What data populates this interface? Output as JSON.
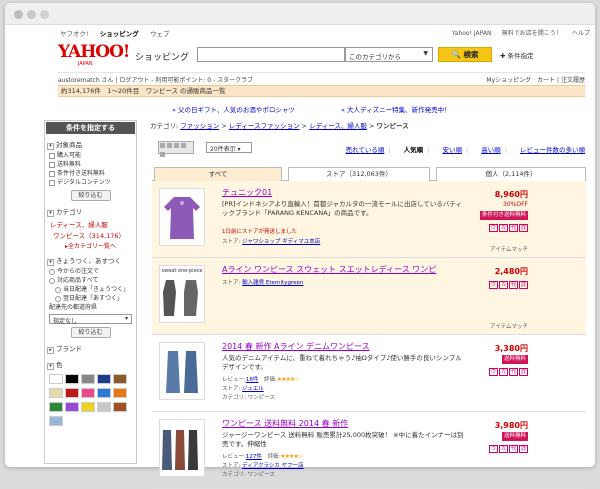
{
  "topnav": {
    "left": [
      "ヤフオク!",
      "ショッピング",
      "ウェブ"
    ],
    "right": [
      "Yahoo! JAPAN",
      "無料でお店を開こう！",
      "ヘルプ"
    ]
  },
  "logo": {
    "text": "YAHOO!",
    "sub": "JAPAN",
    "service": "ショッピング"
  },
  "search": {
    "placeholder": "",
    "category": "このカテゴリから",
    "button": "検索",
    "condition": "条件指定"
  },
  "userbar": {
    "left": "austorematch さん | ログアウト - 利用可能ポイント: 0 - スタークラブ",
    "right": "Myショッピング　カート | 注文履歴"
  },
  "result_bar": "約314,176件　1〜20件目　ワンピース の通販商品一覧",
  "promos": [
    "父の日ギフト、人気のお酒やポロシャツ",
    "大人ディズニー特集、新作発売中！"
  ],
  "sidebar": {
    "title": "条件を指定する",
    "target": {
      "head": "対象商品",
      "options": [
        "購入可能",
        "送料無料",
        "条件付き送料無料",
        "デジタルコンテンツ"
      ],
      "button": "絞り込む"
    },
    "category": {
      "head": "カテゴリ",
      "path": "レディース、婦人服",
      "current": "ワンピース（314,176）",
      "link": "▸全カテゴリー覧へ"
    },
    "delivery": {
      "head": "きょうつく、あすつく",
      "options": [
        "今からの注文で",
        "対応商品すべて",
        "当日配達「きょうつく」",
        "翌日配達「あすつく」"
      ],
      "pref_label": "配達先の都道府県",
      "pref_value": "指定なし",
      "button": "絞り込む"
    },
    "brand": {
      "head": "ブランド"
    },
    "color": {
      "head": "色",
      "swatches": [
        "#ffffff",
        "#000000",
        "#888888",
        "#1a3c8a",
        "#8b5a2b",
        "#e8d8b0",
        "#c01818",
        "#e84a8a",
        "#2a7ad8",
        "#e87818",
        "#2a8a3a",
        "#9a4ad8",
        "#f0d020",
        "#c8c8c8",
        "#a05020",
        "#9ab6d8"
      ]
    }
  },
  "breadcrumb": {
    "label": "カテゴリ:",
    "links": [
      "ファッション",
      "レディースファッション",
      "レディース、婦人服"
    ],
    "current": "ワンピース"
  },
  "sortbar": {
    "per_page": "20件表示",
    "sorts": [
      "売れている順",
      "人気順",
      "安い順",
      "高い順",
      "レビュー件数の多い順"
    ],
    "active": "人気順"
  },
  "tabs": [
    "すべて",
    "ストア（312,063件）",
    "個人（2,114件）"
  ],
  "items": [
    {
      "title": "チュニック01",
      "desc": "[PR]インドネシアより直輸入！首都ジャカルタの一流モールに出店しているバティックブランド「PARANG KENCANA」の商品です。",
      "shipping": "1日前にストアが発送しました",
      "store_label": "ストア:",
      "store": "ジャワショップ ギディマユ本店",
      "price": "8,960円",
      "off": "30%OFF",
      "badge": "条件付き送料無料",
      "tags": [
        "ウ",
        "カ",
        "代",
        "詳"
      ],
      "match": "アイテムマッチ",
      "photo_label": ""
    },
    {
      "title": "Aライン ワンピース スウェット スエットレディース ワンピ",
      "desc": "",
      "shipping": "",
      "store_label": "ストア:",
      "store": "輸入雑貨 Eternitygreen",
      "price": "2,480円",
      "off": "",
      "badge": "",
      "tags": [
        "ウ",
        "カ",
        "代",
        "詳"
      ],
      "match": "アイテムマッチ",
      "photo_label": "sweat one-piece"
    },
    {
      "title": "2014 春 新作 Aライン デニムワンピース",
      "desc": "人気のデニムアイテムに、重ねて着れちゃう♪袖Ωタイプ♪使い勝手の良いシンプルデザインです。",
      "review_label": "レビュー:",
      "reviews": "18件",
      "rating_label": "評価:",
      "store_label": "ストア:",
      "store": "ジュエル",
      "category_label": "カテゴリ:",
      "category": "ワンピース",
      "price": "3,380円",
      "off": "",
      "badge": "送料無料",
      "tags": [
        "ウ",
        "カ",
        "代",
        "詳"
      ],
      "match": "",
      "photo_label": ""
    },
    {
      "title": "ワンピース 送料無料 2014 春 新作",
      "desc": "ジャージーワンピース 送料無料 販売累計25,000枚突破！ ※中に着たインナーは別売です。伸縮性",
      "review_label": "レビュー:",
      "reviews": "127件",
      "rating_label": "評価:",
      "store_label": "ストア:",
      "store": "ディアクラシカ ヤフー店",
      "category_label": "カテゴリ:",
      "category": "ワンピース",
      "price": "3,980円",
      "off": "",
      "badge": "送料無料",
      "tags": [
        "ウ",
        "カ",
        "代",
        "詳"
      ],
      "match": "",
      "photo_label": ""
    }
  ]
}
